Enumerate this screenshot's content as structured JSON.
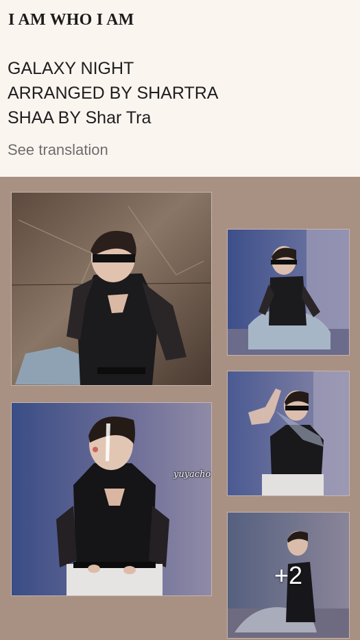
{
  "post": {
    "title": "I AM WHO I AM",
    "lines": [
      "GALAXY NIGHT",
      "ARRANGED BY SHARTRA",
      "SHAA BY Shar Tra"
    ],
    "see_translation": "See translation"
  },
  "gallery": {
    "watermark": "yuyacho",
    "more_count": "+2",
    "photos": [
      {
        "name": "photo-marble-wall",
        "subject": "person in black mesh top against marble wall"
      },
      {
        "name": "photo-blue-elevator-sitting",
        "subject": "person seated in blue-lit elevator"
      },
      {
        "name": "photo-closeup",
        "subject": "person in black sleeveless top, blue background"
      },
      {
        "name": "photo-hand-pose",
        "subject": "person raising hand toward camera"
      },
      {
        "name": "photo-more",
        "subject": "person seated on floor of elevator"
      }
    ]
  },
  "colors": {
    "page_bg": "#fbf5f0",
    "gallery_bg": "#a89083",
    "text": "#1e1e1e",
    "muted": "#6d6d6d"
  }
}
